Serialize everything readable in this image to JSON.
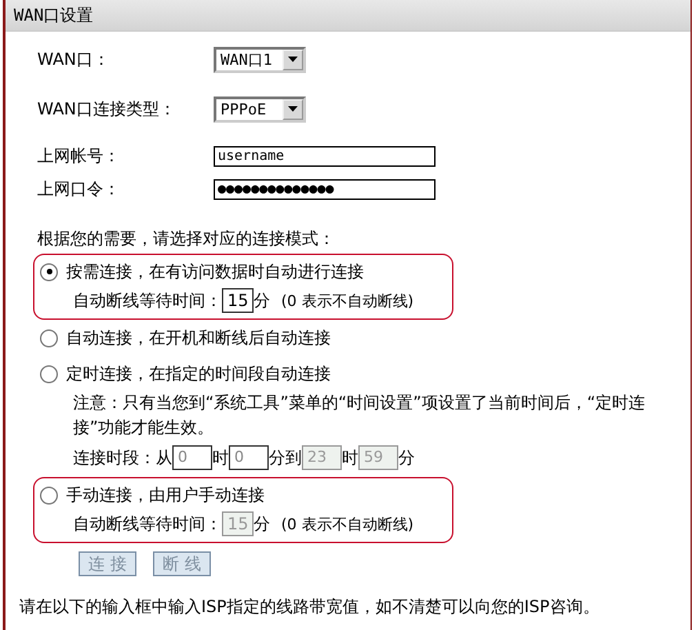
{
  "section": {
    "title": "WAN口设置"
  },
  "fields": [
    {
      "kind": "select",
      "label": "WAN口：",
      "value": "WAN口1"
    },
    {
      "kind": "select",
      "label": "WAN口连接类型：",
      "value": "PPPoE"
    },
    {
      "kind": "text",
      "label": "上网帐号：",
      "value": "username"
    },
    {
      "kind": "password",
      "label": "上网口令：",
      "value": "●●●●●●●●●●●●●●"
    }
  ],
  "mode_prompt": "根据您的需要，请选择对应的连接模式：",
  "modes": [
    {
      "label": "按需连接，在有访问数据时自动进行连接",
      "selected": true,
      "highlighted": true,
      "idle": {
        "label": "自动断线等待时间：",
        "value": "15",
        "unit": "分",
        "hint": "(0 表示不自动断线)",
        "disabled": false
      }
    },
    {
      "label": "自动连接，在开机和断线后自动连接",
      "selected": false
    },
    {
      "label": "定时连接，在指定的时间段自动连接",
      "selected": false,
      "note": "注意：只有当您到“系统工具”菜单的“时间设置”项设置了当前时间后，“定时连接”功能才能生效。",
      "schedule": [
        {
          "kind": "text",
          "text": "连接时段：从"
        },
        {
          "kind": "field",
          "value": "0",
          "disabled": false
        },
        {
          "kind": "text",
          "text": "时"
        },
        {
          "kind": "field",
          "value": "0",
          "disabled": false
        },
        {
          "kind": "text",
          "text": "分到"
        },
        {
          "kind": "field",
          "value": "23",
          "disabled": true
        },
        {
          "kind": "text",
          "text": "时"
        },
        {
          "kind": "field",
          "value": "59",
          "disabled": true
        },
        {
          "kind": "text",
          "text": "分"
        }
      ]
    },
    {
      "label": "手动连接，由用户手动连接",
      "selected": false,
      "highlighted": true,
      "idle": {
        "label": "自动断线等待时间：",
        "value": "15",
        "unit": "分",
        "hint": "(0 表示不自动断线)",
        "disabled": true
      }
    }
  ],
  "buttons": [
    {
      "label": "连 接",
      "disabled": true
    },
    {
      "label": "断 线",
      "disabled": true
    }
  ],
  "footer": "请在以下的输入框中输入ISP指定的线路带宽值，如不清楚可以向您的ISP咨询。"
}
